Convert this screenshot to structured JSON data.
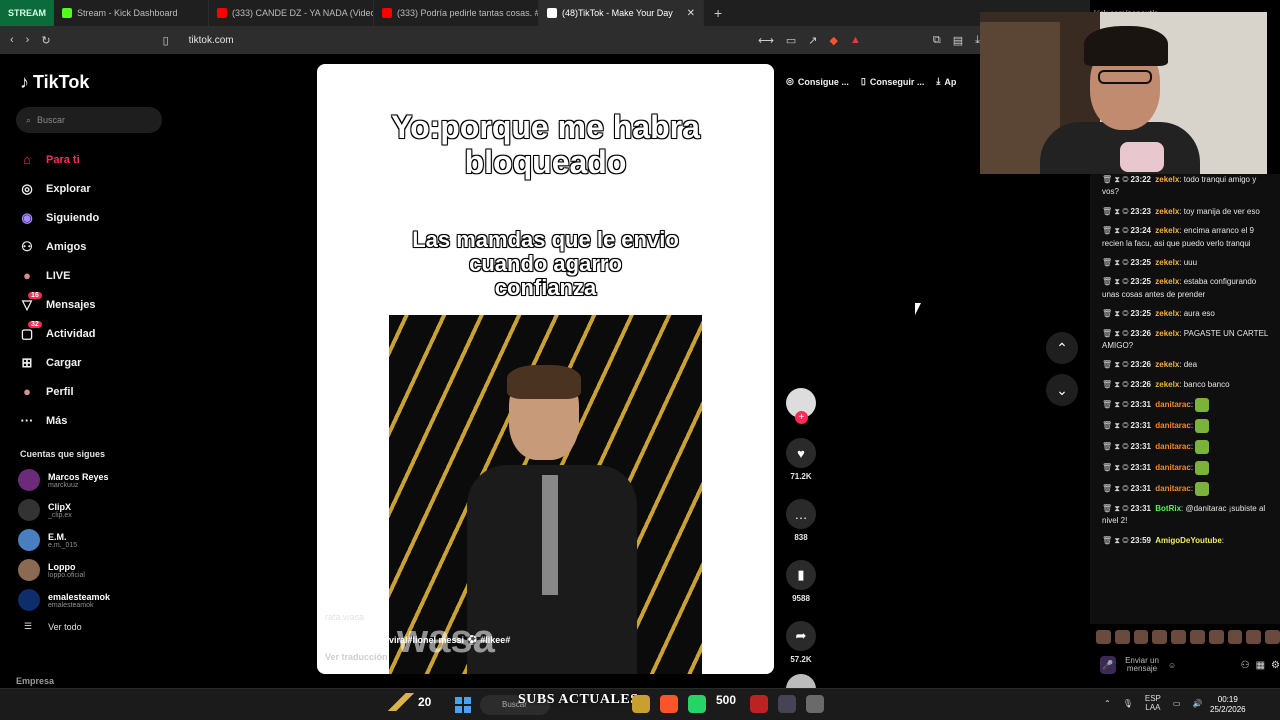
{
  "browser": {
    "stream_tag": "STREAM",
    "tabs": [
      {
        "label": "Stream - Kick Dashboard",
        "color": "#53fc18"
      },
      {
        "label": "(333) CANDE DZ - YA NADA (Video o",
        "color": "#ff0000"
      },
      {
        "label": "(333) Podría pedirle tantas cosas. #p",
        "color": "#ff0000"
      },
      {
        "label": "(48)TikTok - Make Your Day",
        "color": "#ffffff"
      }
    ],
    "url": "tiktok.com",
    "kick_tab": "kick.com/popout/a..."
  },
  "sidebar": {
    "logo": "TikTok",
    "search_placeholder": "Buscar",
    "nav": [
      {
        "label": "Para ti",
        "icon": "home-icon",
        "glyph": "⌂",
        "active": true
      },
      {
        "label": "Explorar",
        "icon": "compass-icon",
        "glyph": "◎"
      },
      {
        "label": "Siguiendo",
        "icon": "following-icon",
        "glyph": "◉"
      },
      {
        "label": "Amigos",
        "icon": "friends-icon",
        "glyph": "👥"
      },
      {
        "label": "LIVE",
        "icon": "live-icon",
        "glyph": "●"
      },
      {
        "label": "Mensajes",
        "icon": "messages-icon",
        "glyph": "▽",
        "badge": "16"
      },
      {
        "label": "Actividad",
        "icon": "activity-icon",
        "glyph": "▢",
        "badge": "32"
      },
      {
        "label": "Cargar",
        "icon": "upload-icon",
        "glyph": "⊞"
      },
      {
        "label": "Perfil",
        "icon": "profile-icon",
        "glyph": "●"
      },
      {
        "label": "Más",
        "icon": "more-icon",
        "glyph": "···"
      }
    ],
    "following_title": "Cuentas que sigues",
    "accounts": [
      {
        "name": "Marcos Reyes",
        "handle": "marckuuz"
      },
      {
        "name": "ClipX",
        "handle": "_clip.ex"
      },
      {
        "name": "E.M.",
        "handle": "e.m._015"
      },
      {
        "name": "Loppo",
        "handle": "loppo.oficial"
      },
      {
        "name": "emalesteamok",
        "handle": "emalesteamok"
      }
    ],
    "see_all": "Ver todo",
    "company": "Empresa"
  },
  "video": {
    "title_line1": "Yo:porque me habra",
    "title_line2": "bloqueado",
    "sub_line1": "Las mamdas que le envio",
    "sub_line2": "cuando agarro",
    "sub_line3": "confianza",
    "username": "rata.wasa",
    "caption": "fyppp#paratiii#viral#lionel messi ⚽ #likee#",
    "translate": "Ver traducción",
    "overlay_word": "wasa"
  },
  "actions": {
    "likes": "71.2K",
    "comments": "838",
    "saves": "9588",
    "shares": "57.2K"
  },
  "top_actions": [
    "Consigue ...",
    "Conseguir ...",
    "Ap"
  ],
  "chat": [
    {
      "time": "23:22",
      "user": "zekelx",
      "cls": "u-z",
      "text": "todo tranqui amigo y vos?"
    },
    {
      "time": "23:23",
      "user": "zekelx",
      "cls": "u-z",
      "text": "toy manija de ver eso"
    },
    {
      "time": "23:24",
      "user": "zekelx",
      "cls": "u-z",
      "text": "encima arranco el 9 recien la facu, asi que puedo verlo tranqui"
    },
    {
      "time": "23:25",
      "user": "zekelx",
      "cls": "u-z",
      "text": "uuu"
    },
    {
      "time": "23:25",
      "user": "zekelx",
      "cls": "u-z",
      "text": "estaba configurando unas cosas antes de prender"
    },
    {
      "time": "23:25",
      "user": "zekelx",
      "cls": "u-z",
      "text": "aura eso"
    },
    {
      "time": "23:26",
      "user": "zekelx",
      "cls": "u-z",
      "text": "PAGASTE UN CARTEL AMIGO?"
    },
    {
      "time": "23:26",
      "user": "zekelx",
      "cls": "u-z",
      "text": "dea"
    },
    {
      "time": "23:26",
      "user": "zekelx",
      "cls": "u-z",
      "text": "banco banco"
    },
    {
      "time": "23:31",
      "user": "danitarac",
      "cls": "u-d",
      "text": "",
      "emote": true
    },
    {
      "time": "23:31",
      "user": "danitarac",
      "cls": "u-d",
      "text": "",
      "emote": true
    },
    {
      "time": "23:31",
      "user": "danitarac",
      "cls": "u-d",
      "text": "",
      "emote": true
    },
    {
      "time": "23:31",
      "user": "danitarac",
      "cls": "u-d",
      "text": "",
      "emote": true
    },
    {
      "time": "23:31",
      "user": "danitarac",
      "cls": "u-d",
      "text": "",
      "emote": true
    },
    {
      "time": "23:31",
      "user": "BotRix",
      "cls": "u-b",
      "text": "@danitarac ¡subiste al nivel 2!"
    },
    {
      "time": "23:59",
      "user": "AmigoDeYoutube",
      "cls": "u-a",
      "text": ""
    }
  ],
  "chat_input_placeholder": "Enviar un mensaje",
  "taskbar": {
    "count": "20",
    "search": "Buscar",
    "subs_label": "SUBS ACTUALES",
    "subs_count": "500",
    "lang": "ESP",
    "region": "LAA",
    "time": "00:19",
    "date": "25/2/2026"
  }
}
